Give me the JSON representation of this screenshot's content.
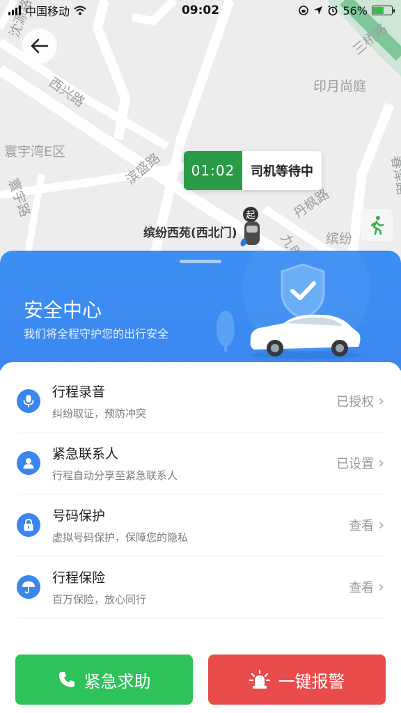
{
  "status_bar": {
    "carrier": "中国移动",
    "time": "09:02",
    "battery_percent": "56%",
    "battery_level": 0.56
  },
  "map": {
    "labels": {
      "xixing_road": "西兴路",
      "huanyu_bay": "寰宇湾E区",
      "binsheng_road": "滨盛路",
      "yinyue": "印月尚庭",
      "sanqiao_road": "三桥路",
      "huanyu_road": "寰宇路",
      "dan_road": "丹枫路",
      "jiujia": "九甲",
      "binfen_east": "缤纷",
      "top_left": "沈源路",
      "right_vertical": "春泽路"
    },
    "wait_timer": "01:02",
    "wait_text": "司机等待中",
    "pickup_name": "缤纷西苑(西北门)",
    "pickup_pin_char": "起"
  },
  "panel": {
    "title": "安全中心",
    "subtitle": "我们将全程守护您的出行安全",
    "items": [
      {
        "title": "行程录音",
        "sub": "纠纷取证，预防冲突",
        "status": "已授权",
        "icon": "microphone-icon"
      },
      {
        "title": "紧急联系人",
        "sub": "行程自动分享至紧急联系人",
        "status": "已设置",
        "icon": "person-icon"
      },
      {
        "title": "号码保护",
        "sub": "虚拟号码保护，保障您的隐私",
        "status": "查看",
        "icon": "lock-icon"
      },
      {
        "title": "行程保险",
        "sub": "百万保险，放心同行",
        "status": "查看",
        "icon": "umbrella-icon"
      }
    ],
    "chevron": "›"
  },
  "actions": {
    "help_label": "紧急求助",
    "alarm_label": "一键报警"
  },
  "colors": {
    "brand_blue": "#3b88ef",
    "wait_green": "#2a9b46",
    "help_green": "#2ec35a",
    "alarm_red": "#e94b4b"
  }
}
